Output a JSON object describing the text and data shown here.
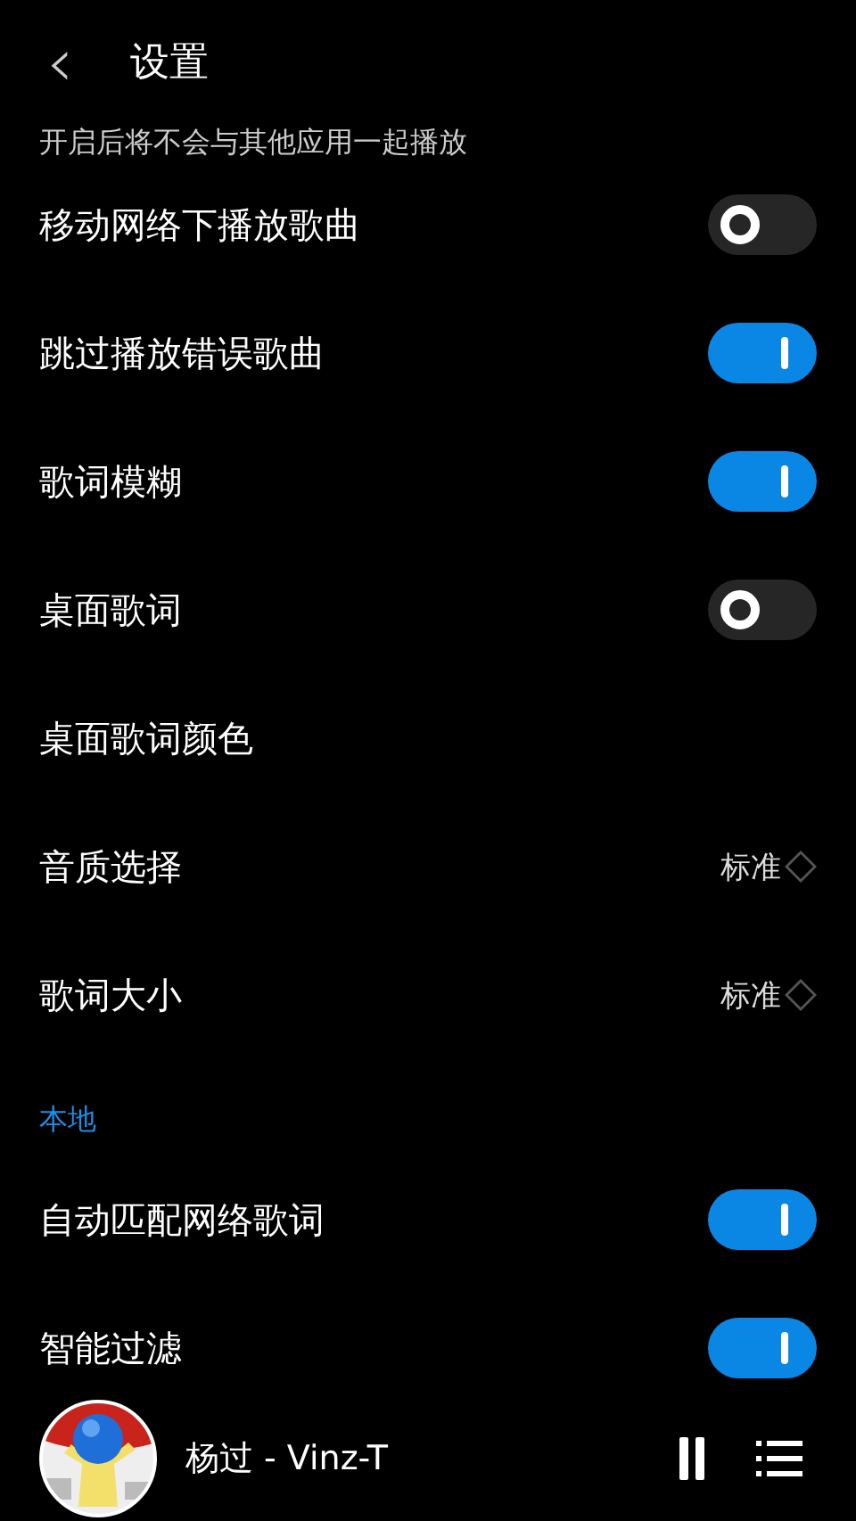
{
  "header": {
    "back_icon": "‹",
    "title": "设置"
  },
  "hint": "开启后将不会与其他应用一起播放",
  "rows": [
    {
      "kind": "toggle",
      "label": "移动网络下播放歌曲",
      "on": false
    },
    {
      "kind": "toggle",
      "label": "跳过播放错误歌曲",
      "on": true
    },
    {
      "kind": "toggle",
      "label": "歌词模糊",
      "on": true
    },
    {
      "kind": "toggle",
      "label": "桌面歌词",
      "on": false
    },
    {
      "kind": "plain",
      "label": "桌面歌词颜色"
    },
    {
      "kind": "value",
      "label": "音质选择",
      "value": "标准"
    },
    {
      "kind": "value",
      "label": "歌词大小",
      "value": "标准"
    }
  ],
  "section": "本地",
  "local_rows": [
    {
      "kind": "toggle",
      "label": "自动匹配网络歌词",
      "on": true
    },
    {
      "kind": "toggle",
      "label": "智能过滤",
      "on": true
    }
  ],
  "player": {
    "track": "杨过 - Vinz-T",
    "playing": true
  }
}
